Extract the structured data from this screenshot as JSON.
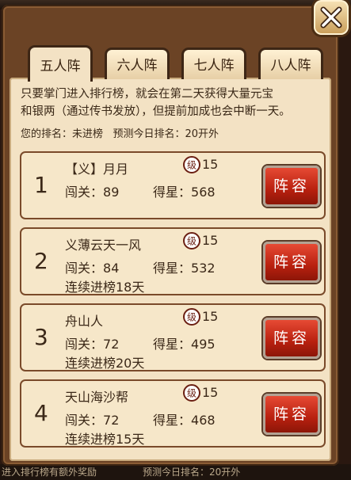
{
  "tabs": [
    {
      "label": "五人阵",
      "active": true
    },
    {
      "label": "六人阵",
      "active": false
    },
    {
      "label": "七人阵",
      "active": false
    },
    {
      "label": "八人阵",
      "active": false
    }
  ],
  "intro": {
    "line1": "只要掌门进入排行榜，就会在第二天获得大量元宝",
    "line2": "和银两（通过传书发放），但提前加成也会中断一天。"
  },
  "my_rank_label": "您的排名：",
  "my_rank_value": "未进榜",
  "predict_label": "预测今日排名：",
  "predict_value": "20开外",
  "rows": [
    {
      "rank": "1",
      "name": "【义】月月",
      "level": "15",
      "stage_label": "闯关：",
      "stage": "89",
      "stars_label": "得星：",
      "stars": "568",
      "streak": "",
      "button": "阵容"
    },
    {
      "rank": "2",
      "name": "义薄云天一风",
      "level": "15",
      "stage_label": "闯关：",
      "stage": "84",
      "stars_label": "得星：",
      "stars": "532",
      "streak": "连续进榜18天",
      "button": "阵容"
    },
    {
      "rank": "3",
      "name": "舟山人",
      "level": "15",
      "stage_label": "闯关：",
      "stage": "72",
      "stars_label": "得星：",
      "stars": "495",
      "streak": "连续进榜20天",
      "button": "阵容"
    },
    {
      "rank": "4",
      "name": "天山海沙帮",
      "level": "15",
      "stage_label": "闯关：",
      "stage": "72",
      "stars_label": "得星：",
      "stars": "468",
      "streak": "连续进榜15天",
      "button": "阵容"
    }
  ],
  "level_badge": "级",
  "footer": {
    "left": "进入排行榜有额外奖励",
    "right": "预测今日排名：20开外"
  },
  "colors": {
    "frame": "#6b4325",
    "panel": "#f3e2c4",
    "button_red": "#c6301c"
  }
}
